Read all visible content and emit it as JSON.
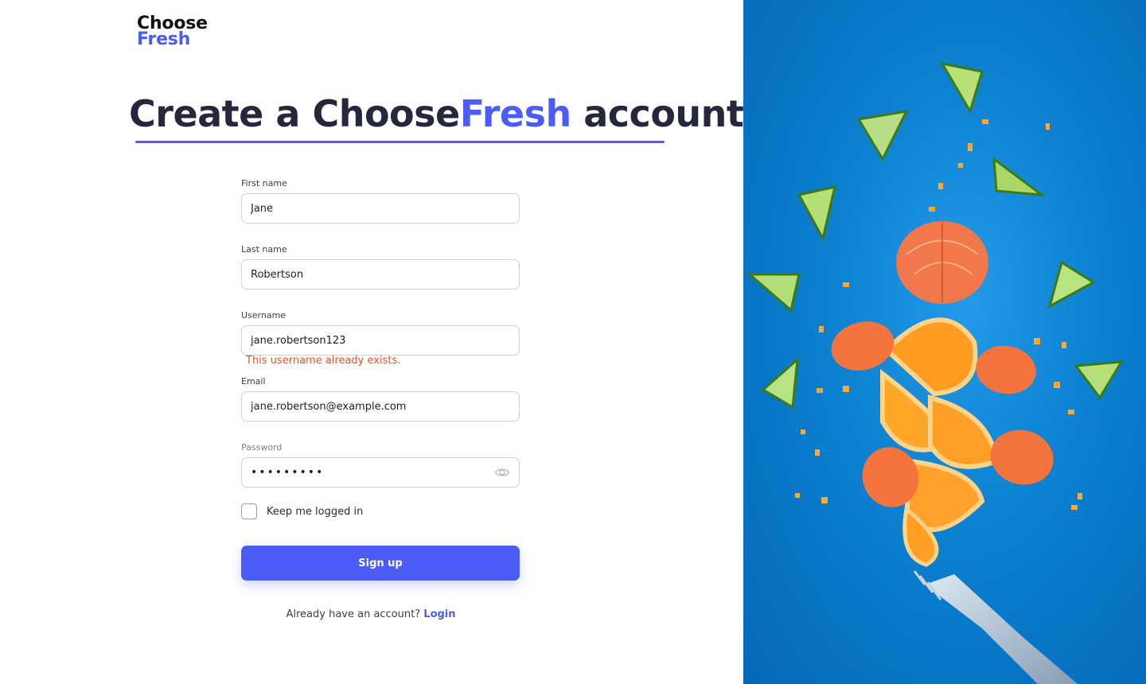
{
  "brand": {
    "line1": "Choose",
    "line2": "Fresh"
  },
  "heading": {
    "before": "Create a Choose",
    "brand": "Fresh",
    "after": " account"
  },
  "form": {
    "first_name": {
      "label": "First name",
      "value": "Jane"
    },
    "last_name": {
      "label": "Last name",
      "value": "Robertson"
    },
    "username": {
      "label": "Username",
      "value": "jane.robertson123",
      "error": "This username already exists."
    },
    "email": {
      "label": "Email",
      "value": "jane.robertson@example.com"
    },
    "password": {
      "label": "Password",
      "value": "•••••••••"
    },
    "keep_logged_in": {
      "label": "Keep me logged in",
      "checked": false
    },
    "submit_label": "Sign up"
  },
  "footer": {
    "prompt": "Already have an account? ",
    "login_label": "Login"
  },
  "colors": {
    "accent": "#4b5cf7",
    "error": "#e0562d",
    "hero_bg": "#0a82d2"
  },
  "icons": {
    "password_toggle": "eye-icon"
  }
}
